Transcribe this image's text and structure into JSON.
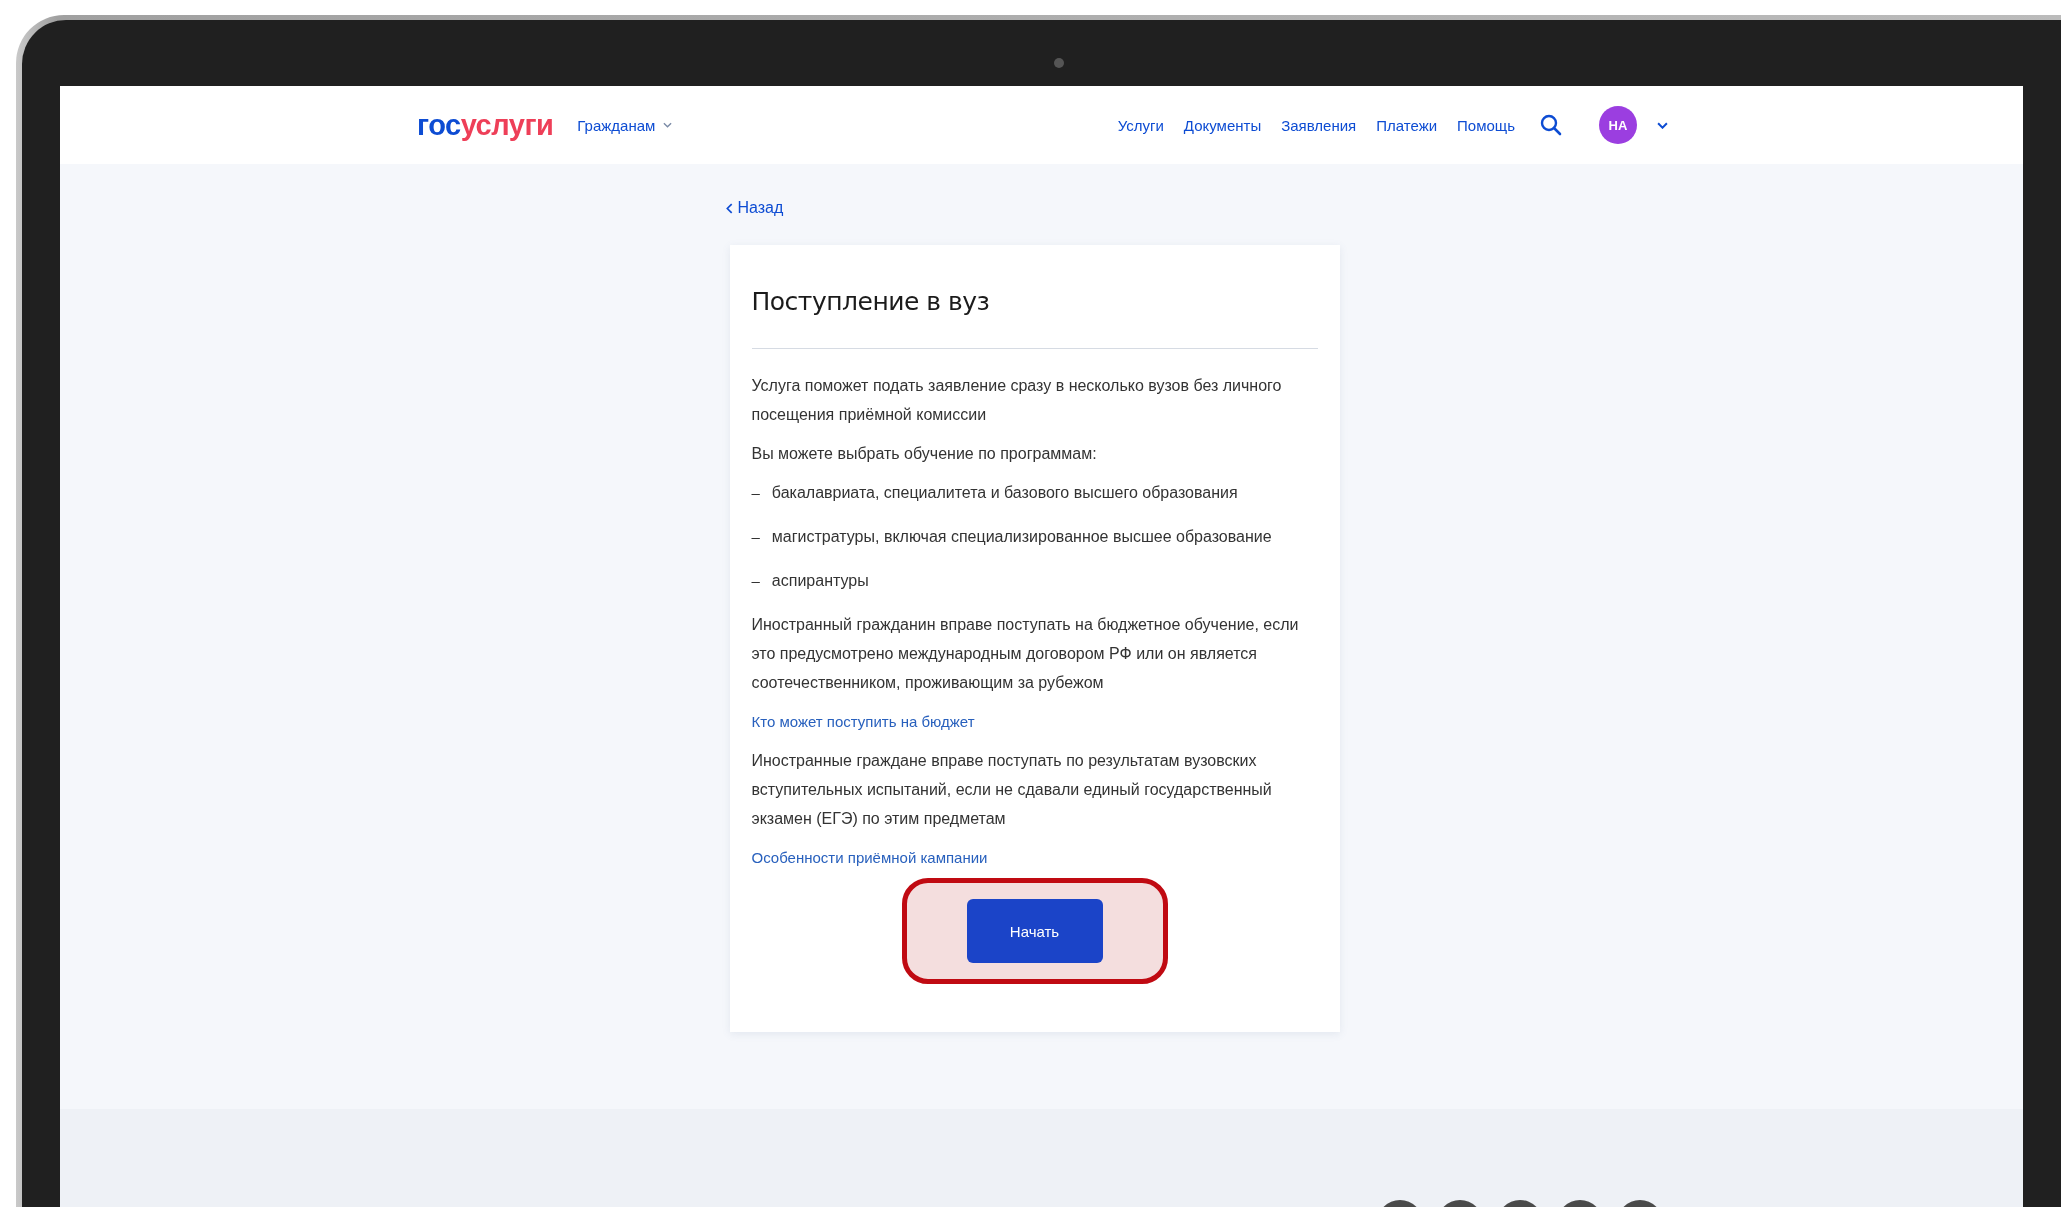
{
  "header": {
    "logo": {
      "part_1": "гос",
      "part_2": "услуги"
    },
    "audience_menu": "Гражданам",
    "nav": [
      "Услуги",
      "Документы",
      "Заявления",
      "Платежи",
      "Помощь"
    ],
    "avatar": "НА"
  },
  "back_link": "Назад",
  "card": {
    "title": "Поступление в вуз",
    "blocks": [
      {
        "kind": "paragraph",
        "text": "Услуга поможет подать заявление сразу в несколько вузов без личного посещения приёмной комиссии"
      },
      {
        "kind": "paragraph",
        "text": "Вы можете выбрать обучение по программам:"
      },
      {
        "kind": "bullet",
        "marker": "–",
        "text": "бакалавриата, специалитета и базового высшего образования"
      },
      {
        "kind": "bullet",
        "marker": "–",
        "text": "магистратуры, включая специализированное высшее образование"
      },
      {
        "kind": "bullet",
        "marker": "–",
        "text": "аспирантуры"
      },
      {
        "kind": "paragraph",
        "text": "Иностранный гражданин вправе поступать на бюджетное обучение, если это предусмотрено международным договором РФ или он является соотечественником, проживающим за рубежом"
      },
      {
        "kind": "link",
        "text": "Кто может поступить на бюджет"
      },
      {
        "kind": "paragraph",
        "text": "Иностранные граждане вправе поступать по результатам вузовских вступительных испытаний, если не сдавали единый государственный экзамен (ЕГЭ) по этим предметам"
      },
      {
        "kind": "link",
        "text": "Особенности приёмной кампании"
      }
    ],
    "button": {
      "label": "Начать",
      "highlighted": true
    }
  }
}
